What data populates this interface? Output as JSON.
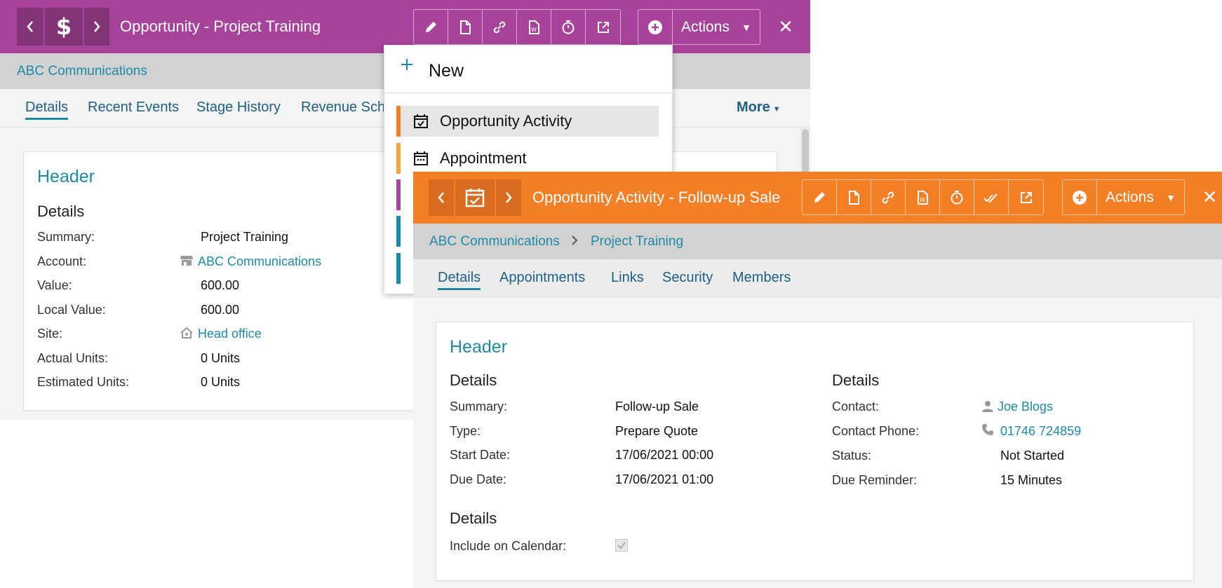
{
  "opportunity_window": {
    "title": "Opportunity - Project Training",
    "breadcrumb": "ABC Communications",
    "tabs": [
      "Details",
      "Recent Events",
      "Stage History",
      "Revenue Sch"
    ],
    "more_label": "More",
    "actions_label": "Actions",
    "header_title": "Header",
    "details_title": "Details",
    "fields": {
      "summary_label": "Summary:",
      "summary": "Project Training",
      "account_label": "Account:",
      "account": "ABC Communications",
      "value_label": "Value:",
      "value": "600.00",
      "local_value_label": "Local Value:",
      "local_value": "600.00",
      "site_label": "Site:",
      "site": "Head office",
      "actual_units_label": "Actual Units:",
      "actual_units": "0 Units",
      "estimated_units_label": "Estimated Units:",
      "estimated_units": "0 Units"
    },
    "accent_color": "#a8439a"
  },
  "new_menu": {
    "new_label": "New",
    "items": [
      {
        "label": "Opportunity Activity",
        "color": "#f57f27"
      },
      {
        "label": "Appointment",
        "color": "#f4a640"
      },
      {
        "label": "",
        "color": "#a8439a"
      },
      {
        "label": "",
        "color": "#1d8aa6"
      },
      {
        "label": "",
        "color": "#1d8aa6"
      }
    ]
  },
  "activity_window": {
    "title": "Opportunity Activity - Follow-up Sale",
    "breadcrumb": [
      "ABC Communications",
      "Project Training"
    ],
    "tabs": [
      "Details",
      "Appointments",
      "Links",
      "Security",
      "Members"
    ],
    "actions_label": "Actions",
    "header_title": "Header",
    "left_details_title": "Details",
    "right_details_title": "Details",
    "extra_details_title": "Details",
    "fields": {
      "summary_label": "Summary:",
      "summary": "Follow-up Sale",
      "type_label": "Type:",
      "type": "Prepare Quote",
      "start_date_label": "Start Date:",
      "start_date": "17/06/2021 00:00",
      "due_date_label": "Due Date:",
      "due_date": "17/06/2021 01:00",
      "contact_label": "Contact:",
      "contact": "Joe Blogs",
      "contact_phone_label": "Contact Phone:",
      "contact_phone": "01746 724859",
      "status_label": "Status:",
      "status": "Not Started",
      "due_reminder_label": "Due Reminder:",
      "due_reminder": "15 Minutes",
      "include_calendar_label": "Include on Calendar:"
    },
    "include_on_calendar": true,
    "accent_color": "#f57f27"
  }
}
